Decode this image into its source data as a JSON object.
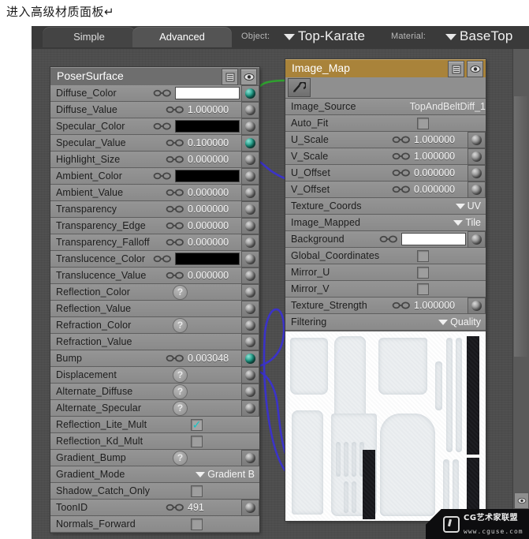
{
  "caption": "进入高级材质面板↵",
  "header": {
    "tabs": [
      {
        "label": "Simple",
        "active": false
      },
      {
        "label": "Advanced",
        "active": true
      }
    ],
    "object_label": "Object:",
    "object_value": "Top-Karate",
    "material_label": "Material:",
    "material_value": "BaseTop"
  },
  "surface_node": {
    "title": "PoserSurface",
    "buttons": [
      "list-icon",
      "eye-icon"
    ],
    "rows": [
      {
        "name": "Diffuse_Color",
        "type": "color",
        "color": "#ffffff",
        "chain": true,
        "plug": "linked"
      },
      {
        "name": "Diffuse_Value",
        "type": "number",
        "value": "1.000000",
        "chain": true,
        "plug": "idle"
      },
      {
        "name": "Specular_Color",
        "type": "color",
        "color": "#000000",
        "chain": true,
        "plug": "idle"
      },
      {
        "name": "Specular_Value",
        "type": "number",
        "value": "0.100000",
        "chain": true,
        "plug": "linked"
      },
      {
        "name": "Highlight_Size",
        "type": "number",
        "value": "0.000000",
        "chain": true,
        "plug": "idle"
      },
      {
        "name": "Ambient_Color",
        "type": "color",
        "color": "#000000",
        "chain": true,
        "plug": "idle"
      },
      {
        "name": "Ambient_Value",
        "type": "number",
        "value": "0.000000",
        "chain": true,
        "plug": "idle"
      },
      {
        "name": "Transparency",
        "type": "number",
        "value": "0.000000",
        "chain": true,
        "plug": "idle"
      },
      {
        "name": "Transparency_Edge",
        "type": "number",
        "value": "0.000000",
        "chain": true,
        "plug": "idle"
      },
      {
        "name": "Transparency_Falloff",
        "type": "number",
        "value": "0.000000",
        "chain": true,
        "plug": "idle"
      },
      {
        "name": "Translucence_Color",
        "type": "color",
        "color": "#000000",
        "chain": true,
        "plug": "idle"
      },
      {
        "name": "Translucence_Value",
        "type": "number",
        "value": "0.000000",
        "chain": true,
        "plug": "idle"
      },
      {
        "name": "Reflection_Color",
        "type": "qmark",
        "value": "?",
        "plug": "idle"
      },
      {
        "name": "Reflection_Value",
        "type": "empty",
        "plug": "idle"
      },
      {
        "name": "Refraction_Color",
        "type": "qmark",
        "value": "?",
        "plug": "idle"
      },
      {
        "name": "Refraction_Value",
        "type": "empty",
        "plug": "idle"
      },
      {
        "name": "Bump",
        "type": "number",
        "value": "0.003048",
        "chain": true,
        "plug": "linked"
      },
      {
        "name": "Displacement",
        "type": "qmark",
        "value": "?",
        "plug": "idle"
      },
      {
        "name": "Alternate_Diffuse",
        "type": "qmark",
        "value": "?",
        "plug": "idle"
      },
      {
        "name": "Alternate_Specular",
        "type": "qmark",
        "value": "?",
        "plug": "idle"
      },
      {
        "name": "Reflection_Lite_Mult",
        "type": "check",
        "checked": true
      },
      {
        "name": "Reflection_Kd_Mult",
        "type": "check",
        "checked": false
      },
      {
        "name": "Gradient_Bump",
        "type": "qmark",
        "value": "?",
        "plug": "idle"
      },
      {
        "name": "Gradient_Mode",
        "type": "dropdown",
        "value": "Gradient B"
      },
      {
        "name": "Shadow_Catch_Only",
        "type": "check",
        "checked": false
      },
      {
        "name": "ToonID",
        "type": "number",
        "value": "491",
        "chain": true,
        "plug": "idle"
      },
      {
        "name": "Normals_Forward",
        "type": "check",
        "checked": false
      }
    ]
  },
  "image_node": {
    "title": "Image_Map",
    "buttons": [
      "list-icon",
      "eye-icon"
    ],
    "browse_button": "browse-image-icon",
    "rows": [
      {
        "name": "Image_Source",
        "type": "source",
        "value": "TopAndBeltDiff_1"
      },
      {
        "name": "Auto_Fit",
        "type": "check",
        "checked": false
      },
      {
        "name": "U_Scale",
        "type": "number",
        "value": "1.000000",
        "chain": true,
        "plug": "idle"
      },
      {
        "name": "V_Scale",
        "type": "number",
        "value": "1.000000",
        "chain": true,
        "plug": "idle"
      },
      {
        "name": "U_Offset",
        "type": "number",
        "value": "0.000000",
        "chain": true,
        "plug": "idle"
      },
      {
        "name": "V_Offset",
        "type": "number",
        "value": "0.000000",
        "chain": true,
        "plug": "idle"
      },
      {
        "name": "Texture_Coords",
        "type": "dropdown",
        "value": "UV"
      },
      {
        "name": "Image_Mapped",
        "type": "dropdown",
        "value": "Tile"
      },
      {
        "name": "Background",
        "type": "color",
        "color": "#ffffff",
        "chain": true,
        "plug": "idle"
      },
      {
        "name": "Global_Coordinates",
        "type": "check",
        "checked": false
      },
      {
        "name": "Mirror_U",
        "type": "check",
        "checked": false
      },
      {
        "name": "Mirror_V",
        "type": "check",
        "checked": false
      },
      {
        "name": "Texture_Strength",
        "type": "number",
        "value": "1.000000",
        "chain": true,
        "plug": "idle"
      },
      {
        "name": "Filtering",
        "type": "dropdown",
        "value": "Quality"
      }
    ]
  },
  "wires": {
    "diffuse_color_wire_color": "#2fa02f",
    "specular_value_wire_color": "#3b33c8",
    "bump_wire_color": "#3b33c8"
  },
  "watermark": {
    "line1": "CG艺术家联盟",
    "line2": "www.cguse.com"
  }
}
